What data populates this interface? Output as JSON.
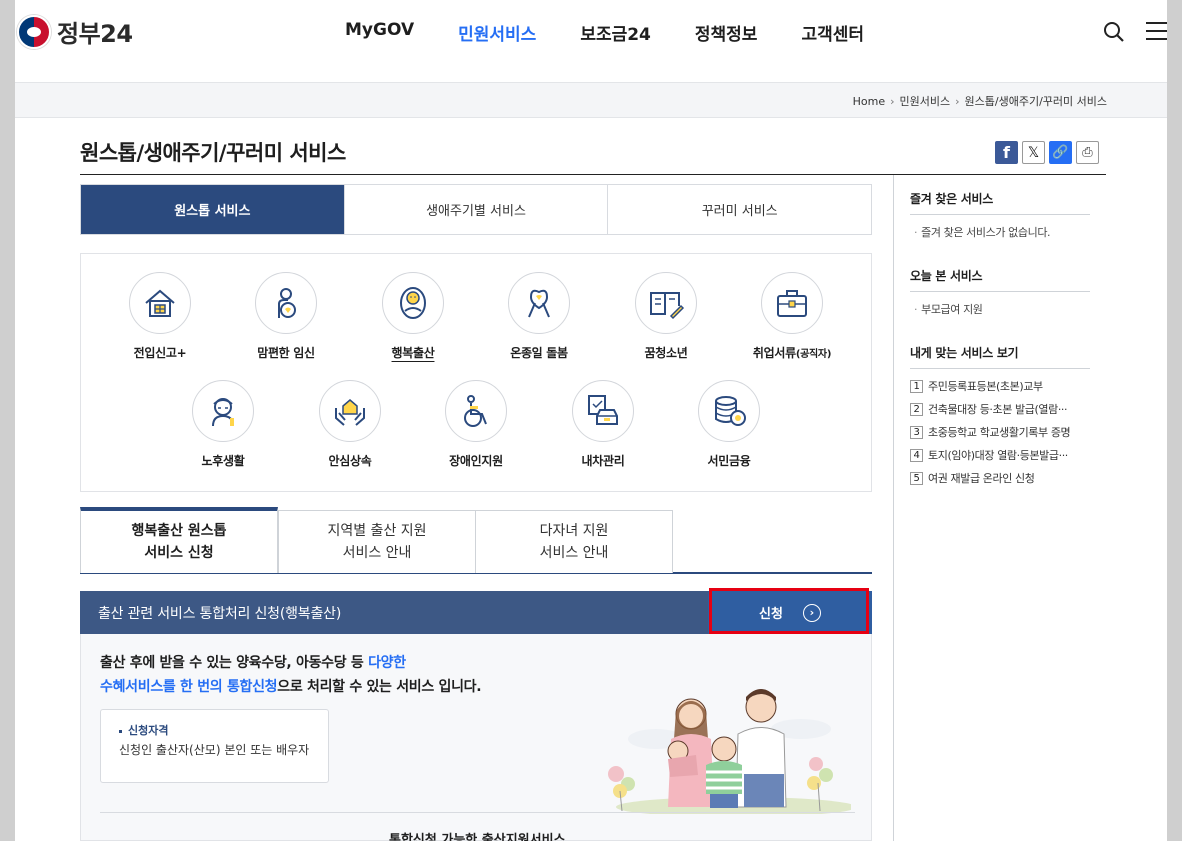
{
  "header": {
    "logo_text": "정부24",
    "nav": [
      "MyGOV",
      "민원서비스",
      "보조금24",
      "정책정보",
      "고객센터"
    ],
    "active_nav": "민원서비스"
  },
  "breadcrumb": [
    "Home",
    "민원서비스",
    "원스톱/생애주기/꾸러미 서비스"
  ],
  "page_title": "원스톱/생애주기/꾸러미 서비스",
  "main_tabs": [
    "원스톱 서비스",
    "생애주기별 서비스",
    "꾸러미 서비스"
  ],
  "active_main_tab": "원스톱 서비스",
  "services": [
    {
      "label": "전입신고+",
      "icon": "house-icon"
    },
    {
      "label": "맘편한 임신",
      "icon": "pregnant-icon"
    },
    {
      "label": "행복출산",
      "icon": "baby-icon"
    },
    {
      "label": "온종일 돌봄",
      "icon": "ribbon-icon"
    },
    {
      "label": "꿈청소년",
      "icon": "book-icon"
    },
    {
      "label": "취업서류",
      "label_small": "(공직자)",
      "icon": "briefcase-icon"
    },
    {
      "label": "노후생활",
      "icon": "elder-icon"
    },
    {
      "label": "안심상속",
      "icon": "hands-house-icon"
    },
    {
      "label": "장애인지원",
      "icon": "wheelchair-icon"
    },
    {
      "label": "내차관리",
      "icon": "car-icon"
    },
    {
      "label": "서민금융",
      "icon": "coins-icon"
    }
  ],
  "selected_service": "행복출산",
  "sub_tabs": [
    {
      "line1": "행복출산 원스톱",
      "line2": "서비스 신청"
    },
    {
      "line1": "지역별 출산 지원",
      "line2": "서비스 안내"
    },
    {
      "line1": "다자녀 지원",
      "line2": "서비스 안내"
    }
  ],
  "apply_bar": {
    "title": "출산 관련 서비스 통합처리 신청(행복출산)",
    "button_label": "신청"
  },
  "lead": {
    "part1": "출산 후에 받을 수 있는 양육수당, 아동수당 등 ",
    "highlight1": "다양한",
    "highlight2": "수혜서비스를 한 번의 통합신청",
    "part2": "으로 처리할 수 있는 서비스 입니다."
  },
  "qualification": {
    "title": "신청자격",
    "desc": "신청인 출산자(산모) 본인 또는 배우자"
  },
  "bottom_title": "통합신청 가능한 출산지원서비스",
  "sidebar": {
    "favorites_title": "즐겨 찾은 서비스",
    "favorites_empty": "즐겨 찾은 서비스가 없습니다.",
    "today_title": "오늘 본 서비스",
    "today_items": [
      "부모급여 지원"
    ],
    "recommend_title": "내게 맞는 서비스 보기",
    "recommend_items": [
      "주민등록표등본(초본)교부",
      "건축물대장 등·초본 발급(열람···",
      "초중등학교 학교생활기록부 증명",
      "토지(임야)대장 열람·등본발급···",
      "여권 재발급 온라인 신청"
    ]
  },
  "colors": {
    "brand_navy": "#2b4a7e",
    "active_nav": "#256ef4",
    "apply_bar": "#3d5885",
    "highlight_box": "#e60012"
  }
}
